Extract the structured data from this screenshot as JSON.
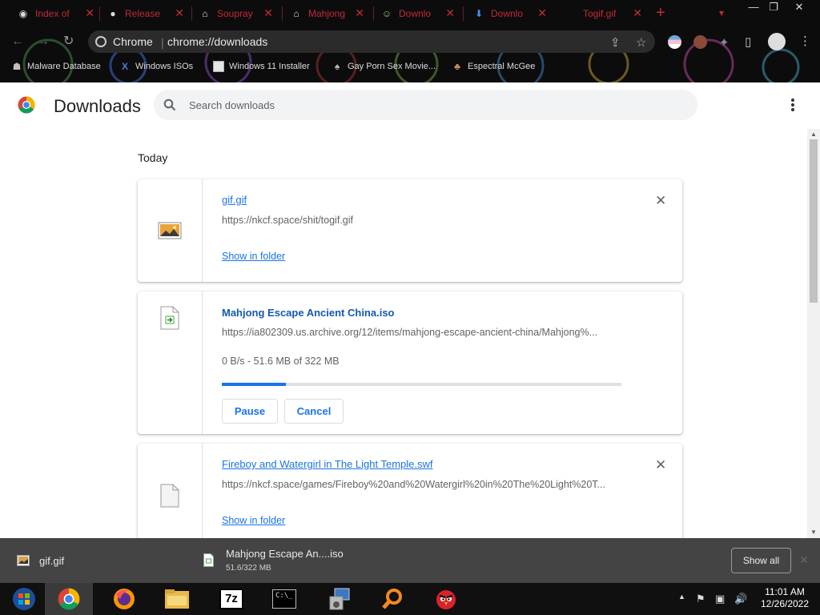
{
  "browser": {
    "tabs": [
      {
        "label": "Index of",
        "icon": "globe-icon"
      },
      {
        "label": "Release",
        "icon": "github-icon"
      },
      {
        "label": "Soupray",
        "icon": "museum-icon"
      },
      {
        "label": "Mahjong",
        "icon": "museum-icon"
      },
      {
        "label": "Downlo",
        "icon": "game-icon"
      },
      {
        "label": "Downlo",
        "icon": "download-icon"
      },
      {
        "label": "Togif.gif",
        "icon": "blank-icon"
      }
    ],
    "omnibox": {
      "site_label": "Chrome",
      "separator": "|",
      "url": "chrome://downloads"
    },
    "bookmarks": [
      {
        "label": "Malware Database",
        "icon": "bug-icon"
      },
      {
        "label": "Windows ISOs",
        "icon": "x-logo-icon"
      },
      {
        "label": "Windows 11 Installer",
        "icon": "image-icon"
      },
      {
        "label": "Gay Porn Sex Movie...",
        "icon": "bookmark-icon"
      },
      {
        "label": "Espectral McGee",
        "icon": "bookmark-icon"
      }
    ]
  },
  "header": {
    "title": "Downloads",
    "search_placeholder": "Search downloads"
  },
  "content": {
    "section_title": "Today",
    "downloads": [
      {
        "name": "gif.gif",
        "url": "https://nkcf.space/shit/togif.gif",
        "link": "Show in folder"
      },
      {
        "name": "Mahjong Escape Ancient China.iso",
        "url": "https://ia802309.us.archive.org/12/items/mahjong-escape-ancient-china/Mahjong%...",
        "progress_text": "0 B/s - 51.6 MB of 322 MB",
        "progress_fraction": 0.16,
        "pause_label": "Pause",
        "cancel_label": "Cancel"
      },
      {
        "name": "Fireboy and Watergirl in The Light Temple.swf",
        "url": "https://nkcf.space/games/Fireboy%20and%20Watergirl%20in%20The%20Light%20T...",
        "link": "Show in folder"
      }
    ]
  },
  "shelf": {
    "items": [
      {
        "name": "gif.gif"
      },
      {
        "name": "Mahjong Escape An....iso",
        "status": "51.6/322 MB"
      }
    ],
    "show_all": "Show all"
  },
  "taskbar": {
    "apps": [
      "windows-start-icon",
      "chrome-icon",
      "firefox-icon",
      "file-explorer-icon",
      "7zip-icon",
      "terminal-icon",
      "installer-icon",
      "search-magnifier-icon",
      "angry-birds-icon"
    ],
    "time": "11:01 AM",
    "date": "12/26/2022"
  },
  "colors": {
    "accent": "#1a73e8",
    "tab_text": "#c2293a",
    "shelf_bg": "#444444",
    "taskbar_bg": "#101010"
  }
}
